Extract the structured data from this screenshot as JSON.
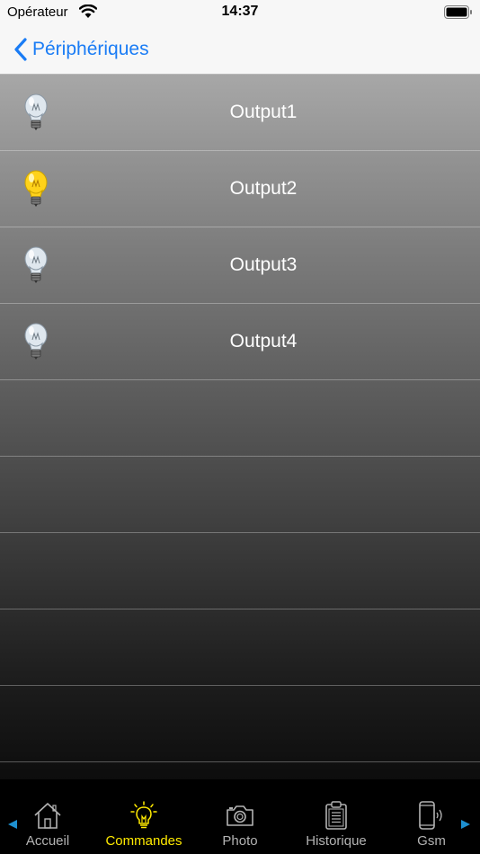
{
  "status_bar": {
    "carrier": "Opérateur",
    "time": "14:37"
  },
  "nav": {
    "back_label": "Périphériques"
  },
  "outputs": [
    {
      "label": "Output1",
      "state": "off"
    },
    {
      "label": "Output2",
      "state": "on"
    },
    {
      "label": "Output3",
      "state": "off"
    },
    {
      "label": "Output4",
      "state": "off"
    }
  ],
  "tabs": [
    {
      "label": "Accueil",
      "icon": "home-icon",
      "active": false
    },
    {
      "label": "Commandes",
      "icon": "bulb-icon",
      "active": true
    },
    {
      "label": "Photo",
      "icon": "camera-icon",
      "active": false
    },
    {
      "label": "Historique",
      "icon": "clipboard-icon",
      "active": false
    },
    {
      "label": "Gsm",
      "icon": "phone-icon",
      "active": false
    }
  ],
  "colors": {
    "accent": "#1a7cf5",
    "active_tab": "#ffea00",
    "bulb_on": "#ffd21a",
    "bulb_off": "#dfe7ee",
    "scroll_arrow": "#1e90d0"
  }
}
